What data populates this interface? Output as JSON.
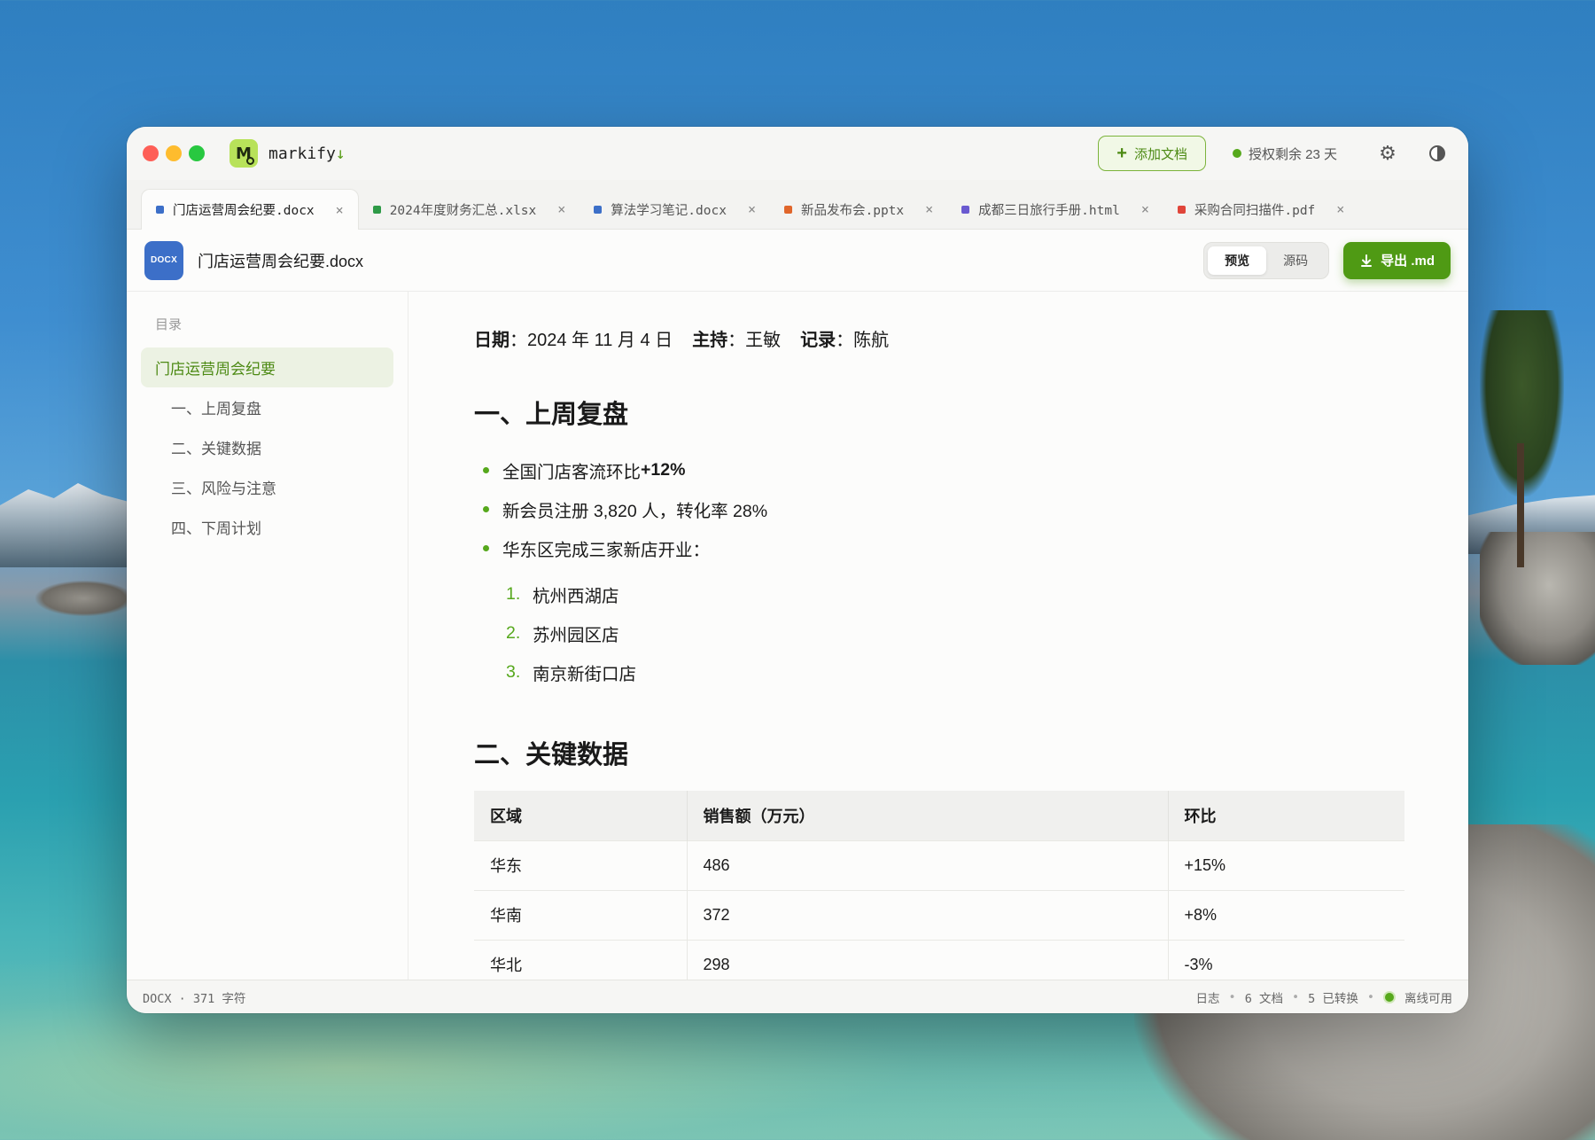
{
  "app": {
    "name": "markify",
    "name_arrow": "↓",
    "logo_letter": "M",
    "add_doc_label": "添加文档",
    "license_text": "授权剩余 23 天",
    "accent": "#56a81c"
  },
  "tabs": [
    {
      "label": "门店运营周会纪要.docx",
      "color": "#3c6fc8",
      "active": true
    },
    {
      "label": "2024年度财务汇总.xlsx",
      "color": "#2e9a47",
      "active": false
    },
    {
      "label": "算法学习笔记.docx",
      "color": "#3c6fc8",
      "active": false
    },
    {
      "label": "新品发布会.pptx",
      "color": "#e0662b",
      "active": false
    },
    {
      "label": "成都三日旅行手册.html",
      "color": "#6a5ad0",
      "active": false
    },
    {
      "label": "采购合同扫描件.pdf",
      "color": "#e0453a",
      "active": false
    }
  ],
  "doc": {
    "badge": "DOCX",
    "title": "门店运营周会纪要.docx",
    "view_preview": "预览",
    "view_source": "源码",
    "export_label": "导出 .md"
  },
  "toc": {
    "heading": "目录",
    "items": [
      {
        "label": "门店运营周会纪要",
        "main": true
      },
      {
        "label": "一、上周复盘"
      },
      {
        "label": "二、关键数据"
      },
      {
        "label": "三、风险与注意"
      },
      {
        "label": "四、下周计划"
      }
    ]
  },
  "content": {
    "meta": [
      {
        "key": "日期",
        "sep": "：",
        "value": "2024 年 11 月 4 日"
      },
      {
        "key": "主持",
        "sep": "：",
        "value": "王敏"
      },
      {
        "key": "记录",
        "sep": "：",
        "value": "陈航"
      }
    ],
    "section1": {
      "title": "一、上周复盘",
      "bullets": [
        {
          "text": "全国门店客流环比 ",
          "bold": "+12%"
        },
        {
          "text": "新会员注册 3,820 人，转化率 28%",
          "bold": ""
        },
        {
          "text": "华东区完成三家新店开业：",
          "bold": ""
        }
      ],
      "ordered": [
        {
          "num": "1.",
          "text": "杭州西湖店"
        },
        {
          "num": "2.",
          "text": "苏州园区店"
        },
        {
          "num": "3.",
          "text": "南京新街口店"
        }
      ]
    },
    "section2": {
      "title": "二、关键数据",
      "headers": [
        "区域",
        "销售额（万元）",
        "环比"
      ],
      "rows": [
        [
          "华东",
          "486",
          "+15%"
        ],
        [
          "华南",
          "372",
          "+8%"
        ],
        [
          "华北",
          "298",
          "-3%"
        ]
      ]
    }
  },
  "status": {
    "left": "DOCX · 371 字符",
    "log": "日志",
    "docs": "6 文档",
    "converted": "5 已转换",
    "offline": "离线可用",
    "dot_sep": "•"
  }
}
